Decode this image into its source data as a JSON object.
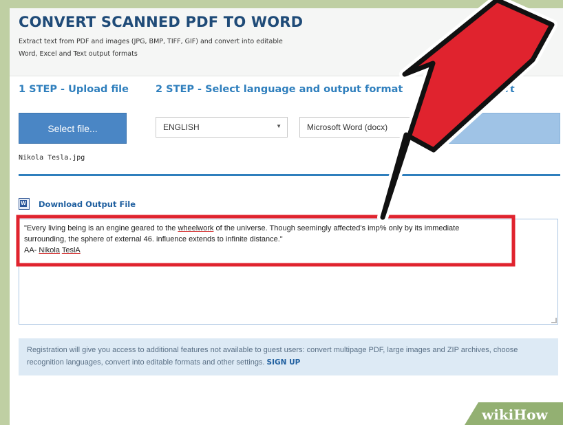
{
  "header": {
    "title": "CONVERT SCANNED PDF TO WORD",
    "subtitle_line1": "Extract text from PDF and images (JPG, BMP, TIFF, GIF) and convert into editable",
    "subtitle_line2": "Word, Excel and Text output formats"
  },
  "steps": {
    "step1": "1 STEP - Upload file",
    "step2": "2 STEP - Select language and output format",
    "step3": "onvert"
  },
  "upload": {
    "select_label": "Select file...",
    "filename": "Nikola Tesla.jpg"
  },
  "options": {
    "language": "ENGLISH",
    "format": "Microsoft Word (docx)"
  },
  "download": {
    "label": "Download Output File"
  },
  "output": {
    "line1": "\"Every living being is an engine geared to the ",
    "word_wheelwork": "wheelwork",
    "line1_rest": " of the universe. Though seemingly affected's imp% only by its immediate",
    "line2": "surrounding, the sphere of external 46. influence extends to infinite distance.\"",
    "line3_prefix": "AA- ",
    "line3_name1": "Nikola",
    "line3_name2": "TeslA"
  },
  "info": {
    "text": "Registration will give you access to additional features not available to guest users: convert multipage PDF, large images and ZIP archives, choose recognition languages, convert into editable formats and other settings. ",
    "signup": "SIGN UP"
  },
  "watermark": {
    "wiki": "wiki",
    "how": "How"
  },
  "colors": {
    "accent": "#2f7fbd",
    "title": "#1f4b78",
    "annotation_red": "#e0232e",
    "button_blue": "#4a86c5"
  }
}
